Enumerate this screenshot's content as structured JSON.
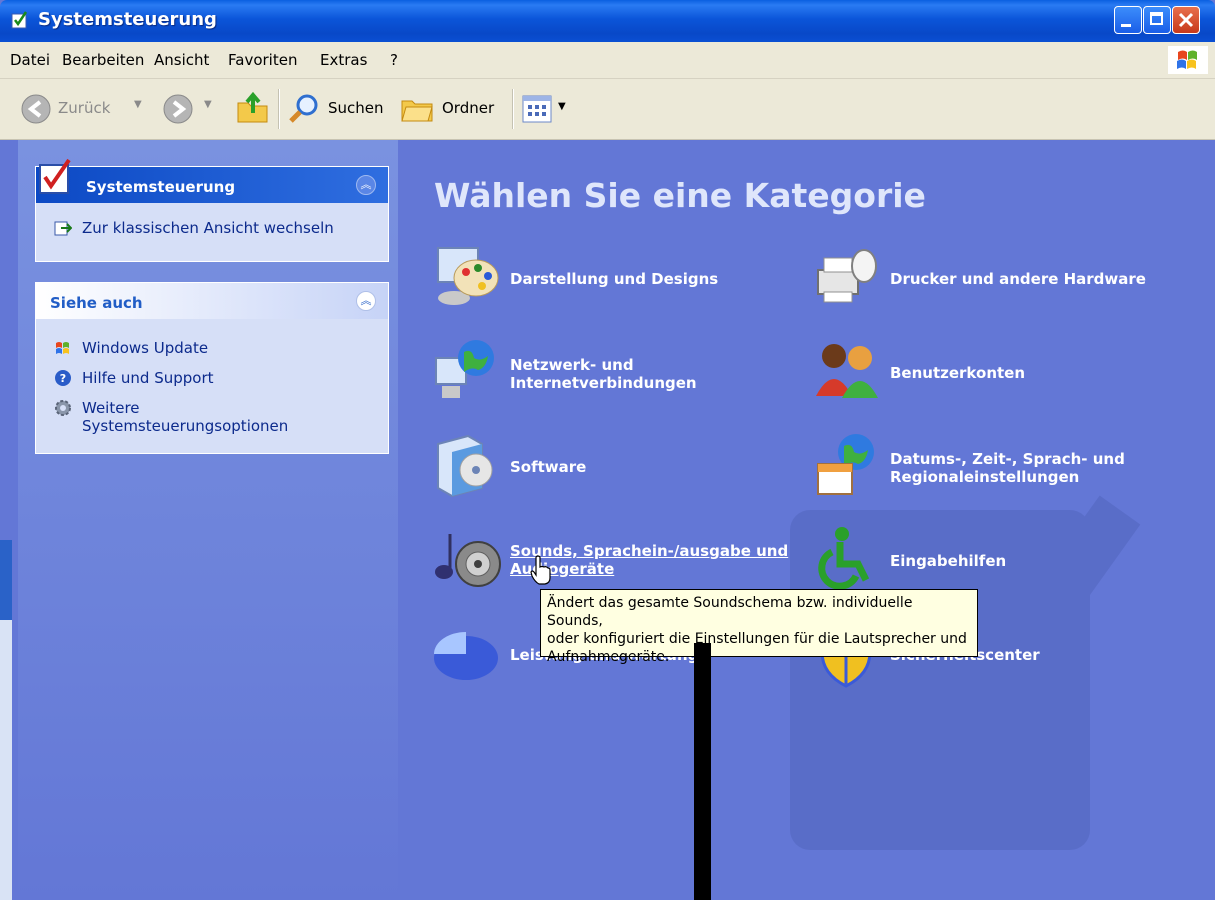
{
  "window": {
    "title": "Systemsteuerung"
  },
  "menu": [
    "Datei",
    "Bearbeiten",
    "Ansicht",
    "Favoriten",
    "Extras",
    "?"
  ],
  "toolbar": {
    "back": "Zurück",
    "search": "Suchen",
    "folders": "Ordner"
  },
  "sidebar": {
    "panel1": {
      "title": "Systemsteuerung",
      "link": "Zur klassischen Ansicht wechseln"
    },
    "panel2": {
      "title": "Siehe auch",
      "links": [
        "Windows Update",
        "Hilfe und Support",
        "Weitere",
        "Systemsteuerungsoptionen"
      ]
    }
  },
  "main": {
    "title": "Wählen Sie eine Kategorie",
    "categories": [
      {
        "label1": "Darstellung und Designs",
        "label2": ""
      },
      {
        "label1": "Drucker und andere Hardware",
        "label2": ""
      },
      {
        "label1": "Netzwerk- und",
        "label2": "Internetverbindungen"
      },
      {
        "label1": "Benutzerkonten",
        "label2": ""
      },
      {
        "label1": "Software",
        "label2": ""
      },
      {
        "label1": "Datums-, Zeit-, Sprach- und",
        "label2": "Regionaleinstellungen"
      },
      {
        "label1": "Sounds, Sprachein-/ausgabe und",
        "label2": "Audiogeräte"
      },
      {
        "label1": "Eingabehilfen",
        "label2": ""
      },
      {
        "label1": "Leistung und Wartung",
        "label2": ""
      },
      {
        "label1": "Sicherheitscenter",
        "label2": ""
      }
    ]
  },
  "tooltip": {
    "line1": "Ändert das gesamte Soundschema bzw. individuelle Sounds,",
    "line2": "oder konfiguriert die Einstellungen für die Lautsprecher und",
    "line3": "Aufnahmegeräte."
  }
}
